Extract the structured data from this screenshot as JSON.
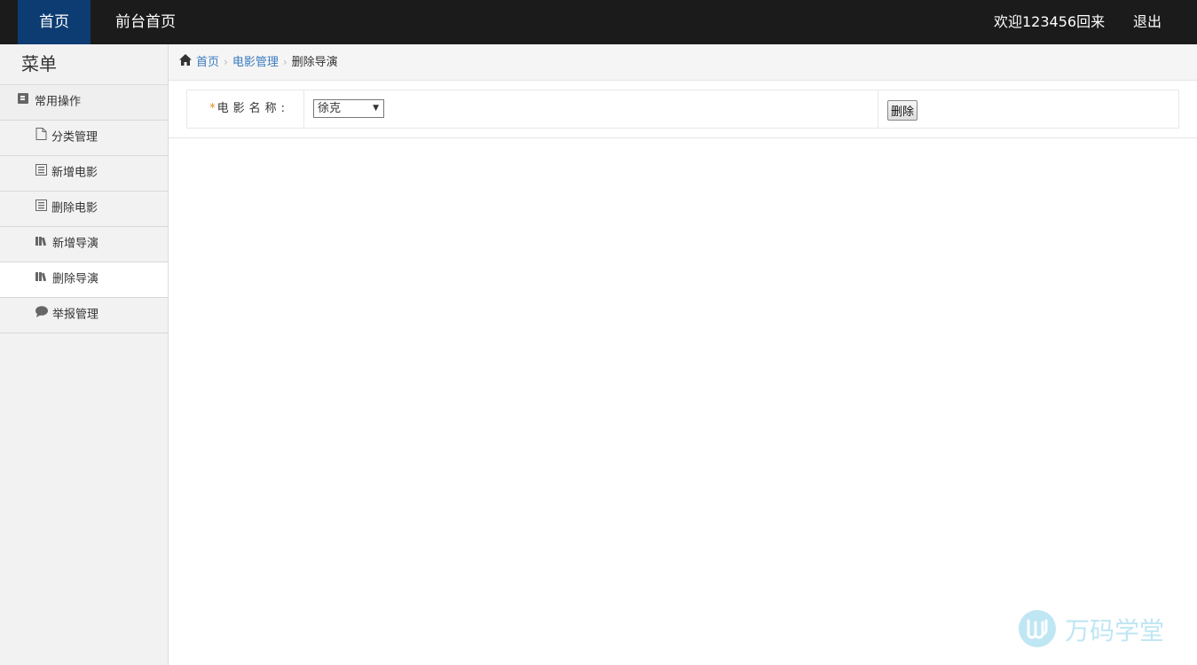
{
  "topbar": {
    "home_label": "首页",
    "front_home_label": "前台首页",
    "welcome_text": "欢迎123456回来",
    "logout_label": "退出"
  },
  "sidebar": {
    "title": "菜单",
    "group": {
      "label": "常用操作",
      "icon": "book-icon"
    },
    "items": [
      {
        "label": "分类管理",
        "icon": "file-icon"
      },
      {
        "label": "新增电影",
        "icon": "list-icon"
      },
      {
        "label": "删除电影",
        "icon": "list-icon"
      },
      {
        "label": "新增导演",
        "icon": "books-icon"
      },
      {
        "label": "删除导演",
        "icon": "books-icon",
        "active": true
      },
      {
        "label": "举报管理",
        "icon": "comment-icon"
      }
    ]
  },
  "breadcrumb": {
    "home": "首页",
    "parent": "电影管理",
    "current": "删除导演"
  },
  "form": {
    "required_mark": "*",
    "label": "电影名称:",
    "select_value": "徐克",
    "delete_label": "删除"
  },
  "watermark": {
    "text": "万码学堂"
  },
  "colors": {
    "topbar_bg": "#1b1b1b",
    "active_nav_bg": "#0d3c73",
    "link": "#3a7bbd",
    "required": "#e08a1e"
  }
}
